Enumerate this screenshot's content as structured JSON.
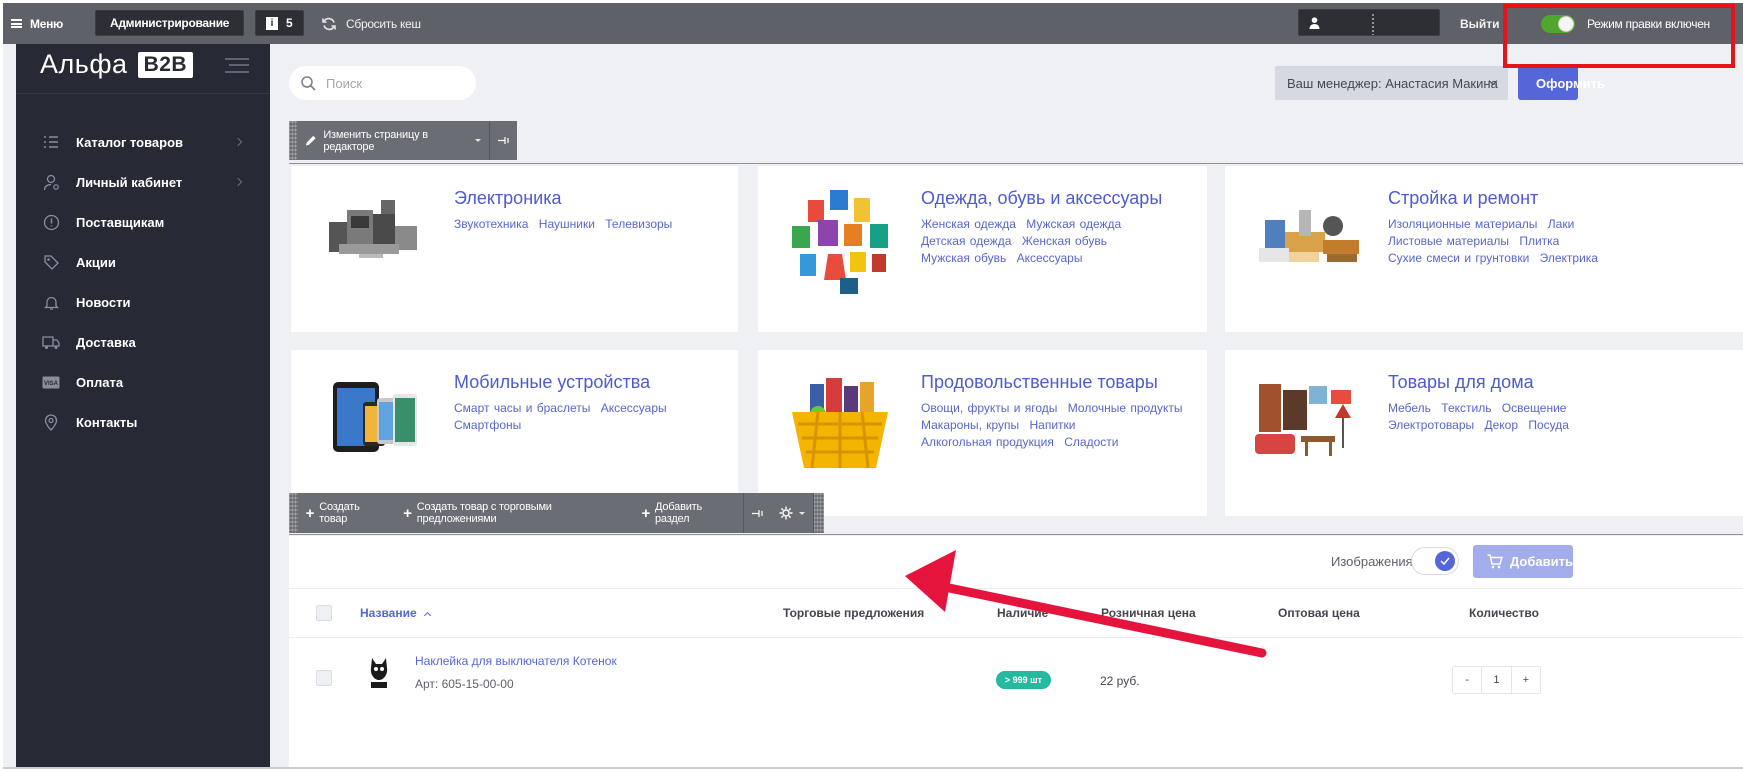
{
  "topbar": {
    "menu_label": "Меню",
    "admin_label": "Администрирование",
    "notif_count": "5",
    "cache_label": "Сбросить кеш",
    "logout_label": "Выйти",
    "edit_mode_label": "Режим правки включен"
  },
  "sidebar": {
    "logo_text": "Альфа",
    "logo_badge": "B2B",
    "items": [
      {
        "label": "Каталог товаров",
        "icon": "list-icon"
      },
      {
        "label": "Личный кабинет",
        "icon": "user-icon"
      },
      {
        "label": "Поставщикам",
        "icon": "info-icon"
      },
      {
        "label": "Акции",
        "icon": "tag-icon"
      },
      {
        "label": "Новости",
        "icon": "bell-icon"
      },
      {
        "label": "Доставка",
        "icon": "truck-icon"
      },
      {
        "label": "Оплата",
        "icon": "visa-icon"
      },
      {
        "label": "Контакты",
        "icon": "pin-icon"
      }
    ]
  },
  "header": {
    "search_placeholder": "Поиск",
    "manager_label": "Ваш менеджер: Анастасия Макина",
    "order_label": "Оформить"
  },
  "editor": {
    "edit_page_label": "Изменить страницу в редакторе",
    "create_product": "Создать товар",
    "create_product_offers": "Создать товар с торговыми предложениями",
    "add_section": "Добавить раздел"
  },
  "categories": [
    {
      "title": "Электроника",
      "links": [
        "Звукотехника",
        "Наушники",
        "Телевизоры"
      ]
    },
    {
      "title": "Одежда, обувь и аксессуары",
      "links": [
        "Женская одежда",
        "Мужская одежда",
        "Детская одежда",
        "Женская обувь",
        "Мужская обувь",
        "Аксессуары"
      ]
    },
    {
      "title": "Стройка и ремонт",
      "links": [
        "Изоляционные материалы",
        "Лаки",
        "Листовые материалы",
        "Плитка",
        "Сухие смеси и грунтовки",
        "Электрика"
      ]
    },
    {
      "title": "Мобильные устройства",
      "links": [
        "Смарт часы и браслеты",
        "Аксессуары",
        "Смартфоны"
      ]
    },
    {
      "title": "Продовольственные товары",
      "links": [
        "Овощи, фрукты и ягоды",
        "Молочные продукты",
        "Макароны, крупы",
        "Напитки",
        "Алкогольная продукция",
        "Сладости"
      ]
    },
    {
      "title": "Товары для дома",
      "links": [
        "Мебель",
        "Текстиль",
        "Освещение",
        "Электротовары",
        "Декор",
        "Посуда"
      ]
    }
  ],
  "table": {
    "images_label": "Изображения",
    "add_button": "Добавить",
    "columns": [
      "Название",
      "Торговые предложения",
      "Наличие",
      "Розничная цена",
      "Оптовая цена",
      "Количество"
    ],
    "rows": [
      {
        "name": "Наклейка для выключателя Котенок",
        "article": "Арт: 605-15-00-00",
        "stock": "> 999 шт",
        "price": "22 руб.",
        "qty_minus": "-",
        "qty": "1",
        "qty_plus": "+"
      }
    ]
  },
  "colors": {
    "accent": "#5566d8",
    "sidebar_bg": "#272a35",
    "topbar_bg": "#5f6168",
    "highlight_red": "#e5141b",
    "stock_green": "#25b9a0"
  }
}
